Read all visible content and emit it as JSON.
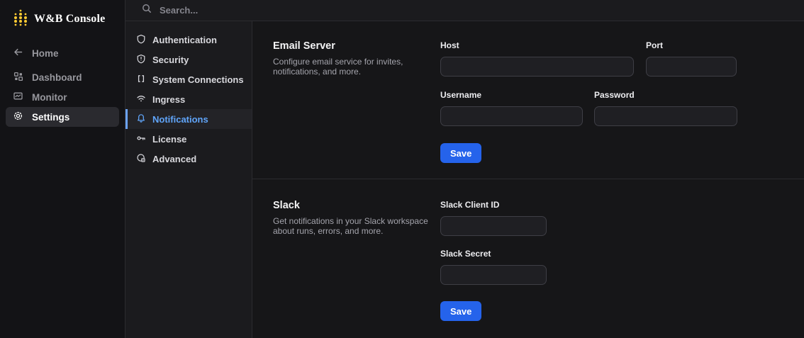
{
  "brand": {
    "title": "W&B Console"
  },
  "topbar": {
    "search_placeholder": "Search..."
  },
  "sidebar": {
    "items": [
      {
        "label": "Home",
        "icon": "back-arrow-icon",
        "active": false
      },
      {
        "label": "Dashboard",
        "icon": "dashboard-grid-icon",
        "active": false
      },
      {
        "label": "Monitor",
        "icon": "monitor-chart-icon",
        "active": false
      },
      {
        "label": "Settings",
        "icon": "gear-icon",
        "active": true
      }
    ]
  },
  "settings_nav": {
    "items": [
      {
        "label": "Authentication",
        "icon": "shield-icon",
        "active": false
      },
      {
        "label": "Security",
        "icon": "shield-alert-icon",
        "active": false
      },
      {
        "label": "System Connections",
        "icon": "brackets-icon",
        "active": false
      },
      {
        "label": "Ingress",
        "icon": "wifi-icon",
        "active": false
      },
      {
        "label": "Notifications",
        "icon": "bell-icon",
        "active": true
      },
      {
        "label": "License",
        "icon": "key-icon",
        "active": false
      },
      {
        "label": "Advanced",
        "icon": "advanced-gear-icon",
        "active": false
      }
    ]
  },
  "sections": [
    {
      "title": "Email Server",
      "description": "Configure email service for invites, notifications, and more.",
      "fields": [
        {
          "label": "Host",
          "value": ""
        },
        {
          "label": "Port",
          "value": ""
        },
        {
          "label": "Username",
          "value": ""
        },
        {
          "label": "Password",
          "value": ""
        }
      ],
      "save_label": "Save"
    },
    {
      "title": "Slack",
      "description": "Get notifications in your Slack workspace about runs, errors, and more.",
      "fields": [
        {
          "label": "Slack Client ID",
          "value": ""
        },
        {
          "label": "Slack Secret",
          "value": ""
        }
      ],
      "save_label": "Save"
    }
  ],
  "colors": {
    "brand_gold": "#FFCC33",
    "accent_blue": "#2563eb",
    "selected_blue": "#60a5fa",
    "panel_bg": "#1b1b1e",
    "main_bg": "#161618",
    "sidebar_bg": "#131316"
  }
}
